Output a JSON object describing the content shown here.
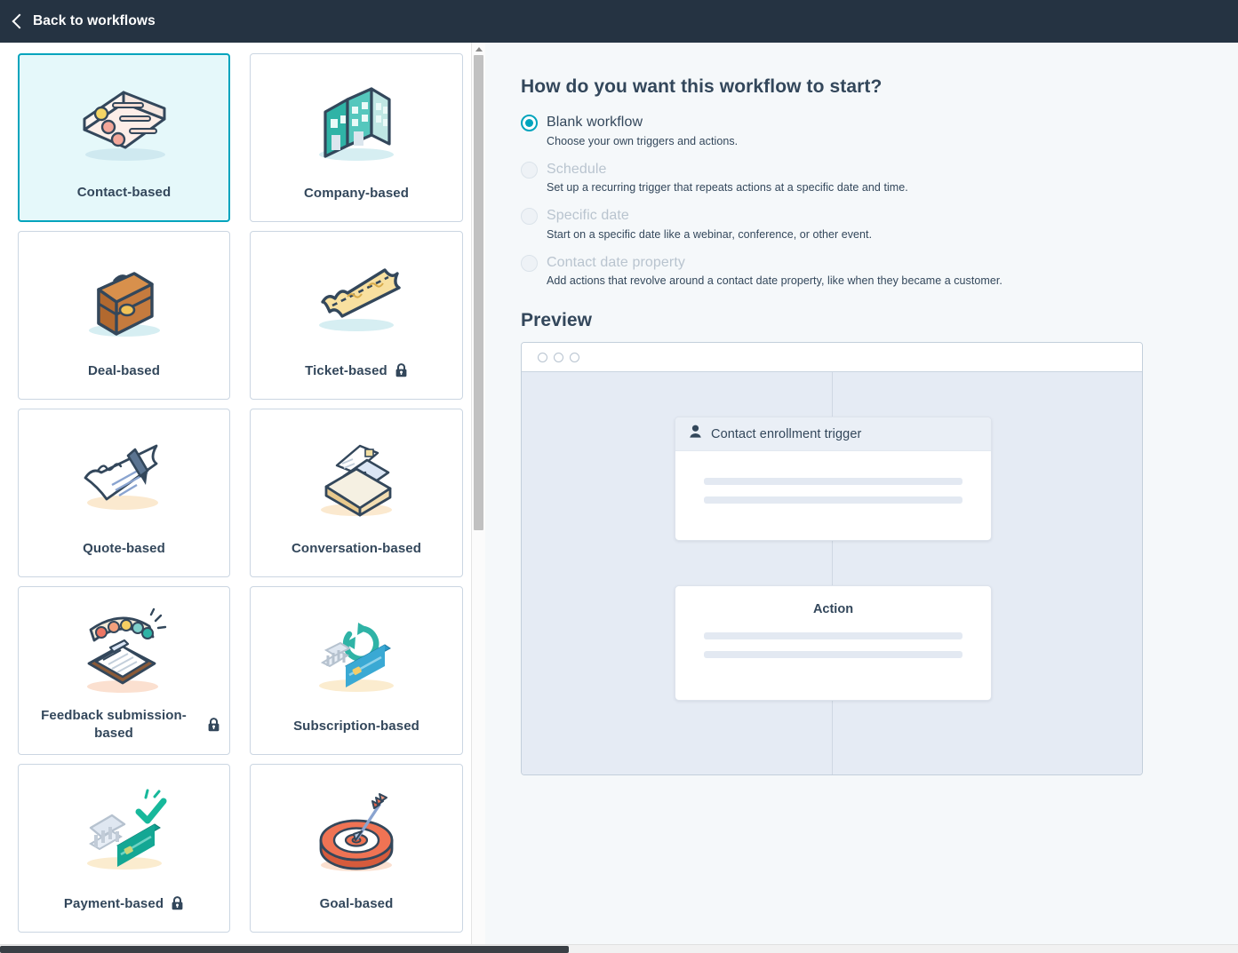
{
  "topbar": {
    "back_label": "Back to workflows",
    "back_icon": "chevron-left-icon",
    "background": "#253342"
  },
  "workflow_types": {
    "selected_index": 0,
    "cards": [
      {
        "label": "Contact-based",
        "icon": "contact-cards-icon",
        "locked": false,
        "selected": true
      },
      {
        "label": "Company-based",
        "icon": "office-building-icon",
        "locked": false,
        "selected": false
      },
      {
        "label": "Deal-based",
        "icon": "briefcase-icon",
        "locked": false,
        "selected": false
      },
      {
        "label": "Ticket-based",
        "icon": "ticket-icon",
        "locked": true,
        "selected": false
      },
      {
        "label": "Quote-based",
        "icon": "signed-document-icon",
        "locked": false,
        "selected": false
      },
      {
        "label": "Conversation-based",
        "icon": "inbox-envelope-icon",
        "locked": false,
        "selected": false
      },
      {
        "label": "Feedback submission-based",
        "icon": "feedback-clipboard-icon",
        "locked": true,
        "selected": false
      },
      {
        "label": "Subscription-based",
        "icon": "subscription-recurring-icon",
        "locked": false,
        "selected": false
      },
      {
        "label": "Payment-based",
        "icon": "payment-bank-card-icon",
        "locked": true,
        "selected": false
      },
      {
        "label": "Goal-based",
        "icon": "target-bullseye-icon",
        "locked": false,
        "selected": false
      }
    ]
  },
  "start_options": {
    "heading": "How do you want this workflow to start?",
    "options": [
      {
        "title": "Blank workflow",
        "description": "Choose your own triggers and actions.",
        "selected": true,
        "disabled": false
      },
      {
        "title": "Schedule",
        "description": "Set up a recurring trigger that repeats actions at a specific date and time.",
        "selected": false,
        "disabled": true
      },
      {
        "title": "Specific date",
        "description": "Start on a specific date like a webinar, conference, or other event.",
        "selected": false,
        "disabled": true
      },
      {
        "title": "Contact date property",
        "description": "Add actions that revolve around a contact date property, like when they became a customer.",
        "selected": false,
        "disabled": true
      }
    ]
  },
  "preview": {
    "heading": "Preview",
    "window_dots": 3,
    "trigger_card": {
      "label": "Contact enrollment trigger",
      "icon": "contact-person-icon",
      "skeleton_lines": 2
    },
    "action_card": {
      "label": "Action",
      "skeleton_lines": 2
    }
  },
  "colors": {
    "header_bg": "#253342",
    "accent_teal": "#00a4bd",
    "selected_card_bg": "#e5f8fa",
    "panel_bg": "#f5f8fa",
    "canvas_bg": "#e5ebf4",
    "text_primary": "#33475b",
    "text_muted": "#b9c4cf"
  }
}
